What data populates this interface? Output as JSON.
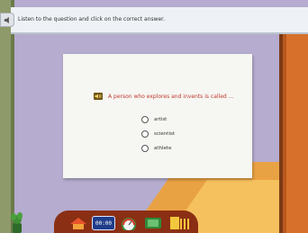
{
  "header": {
    "instruction": "Listen to the question and click on the correct answer."
  },
  "question": {
    "text": "A person who explores and invents is called ...",
    "options": [
      {
        "label": "artist"
      },
      {
        "label": "scientist"
      },
      {
        "label": "athlete"
      }
    ]
  },
  "toolbar": {
    "clock_display": "00:00"
  },
  "colors": {
    "question_text": "#c0392b",
    "wall": "#b5accf",
    "header_bg": "#eef2f6",
    "door": "#d6702a",
    "toolbar": "#8b2f14"
  },
  "icons": [
    "speaker-icon",
    "question-audio-icon",
    "home-icon",
    "clock-icon",
    "gauge-icon",
    "book-icon",
    "door-exit-icon",
    "plant-icon"
  ]
}
